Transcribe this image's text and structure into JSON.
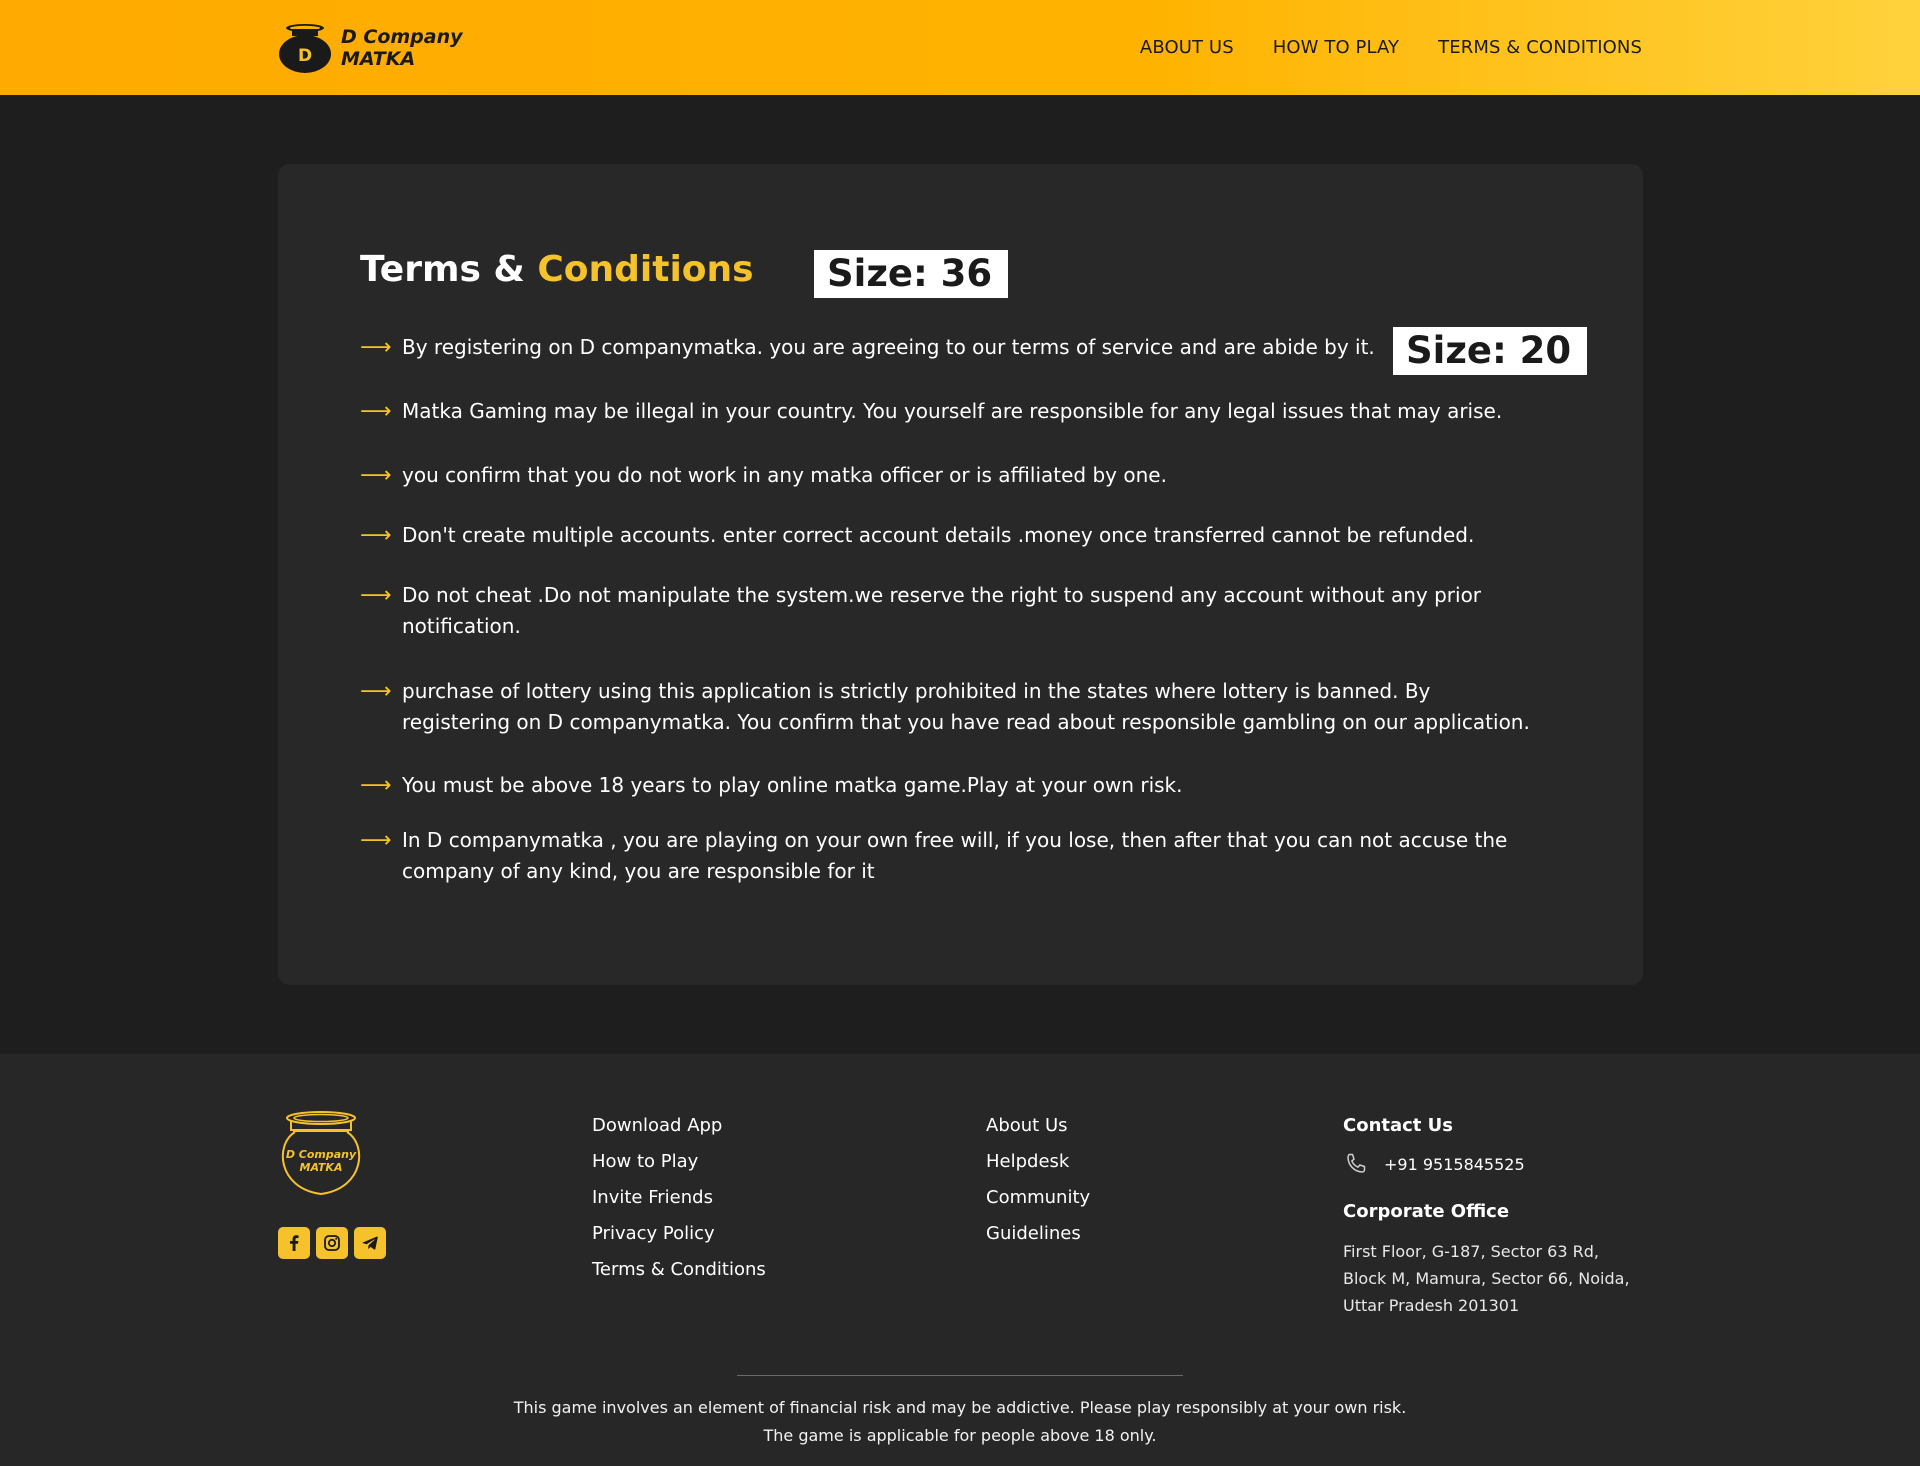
{
  "header": {
    "brand_line1": "D Company",
    "brand_line2": "MATKA",
    "brand_badge": "D",
    "nav": [
      "ABOUT US",
      "HOW TO PLAY",
      "TERMS & CONDITIONS"
    ]
  },
  "main": {
    "title_part1": "Terms & ",
    "title_part2": "Conditions",
    "size_tags": [
      "Size: 36",
      "Size: 20"
    ],
    "arrow_glyph": "⟶",
    "terms": [
      "By registering on D companymatka. you are agreeing to our terms of service and are abide by it.",
      "Matka Gaming may be illegal in your country. You yourself are responsible for any legal issues that may arise.",
      "you confirm that you do not work in any matka officer or is affiliated by one.",
      "Don't create multiple accounts. enter correct account details .money once transferred cannot be refunded.",
      "Do not cheat .Do not manipulate the system.we reserve the right to suspend any account without any prior notification.",
      "purchase of lottery using this application is strictly prohibited in the states where lottery is banned. By registering on D companymatka. You confirm that you have read about responsible gambling on our application.",
      "You must be above 18 years to play online matka game.Play at your own risk.",
      "In D companymatka , you are playing on your own free will, if you lose, then after that you can not accuse the company of any kind, you are responsible for it"
    ]
  },
  "footer": {
    "logo_line1": "D Company",
    "logo_line2": "MATKA",
    "social_icons": [
      "facebook-icon",
      "instagram-icon",
      "telegram-icon"
    ],
    "col1": [
      "Download App",
      "How to Play",
      "Invite Friends",
      "Privacy Policy",
      "Terms & Conditions"
    ],
    "col2": [
      "About Us",
      "Helpdesk",
      "Community",
      "Guidelines"
    ],
    "contact_heading": "Contact Us",
    "phone": "+91 9515845525",
    "office_heading": "Corporate Office",
    "address_lines": [
      "First Floor, G-187, Sector 63 Rd,",
      "Block M, Mamura, Sector 66, Noida,",
      "Uttar Pradesh 201301"
    ],
    "disclaimer_lines": [
      "This game involves an element of financial risk and may be addictive. Please play responsibly at your own risk.",
      "The game is applicable for people above 18 only."
    ]
  },
  "colors": {
    "accent": "#f6c22c",
    "header_gradient_start": "#ffaa00",
    "header_gradient_end": "#ffd23c",
    "page_bg": "#1e1e1e",
    "card_bg": "#282828",
    "footer_bg": "#272727"
  }
}
